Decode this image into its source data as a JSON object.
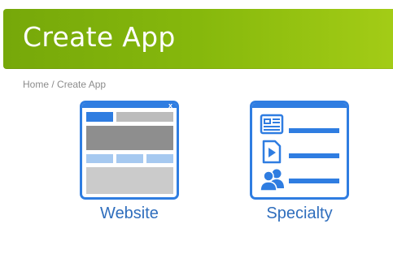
{
  "header": {
    "title": "Create App"
  },
  "breadcrumb": {
    "home": "Home",
    "separator": " / ",
    "current": "Create App"
  },
  "tiles": [
    {
      "label": "Website",
      "icon": "website-layout-icon",
      "close_glyph": "x"
    },
    {
      "label": "Specialty",
      "icon": "specialty-list-icon"
    }
  ],
  "colors": {
    "header_start": "#76a80a",
    "header_end": "#a3cc16",
    "accent_blue": "#2f7de1",
    "label_blue": "#2f6ebd",
    "breadcrumb_gray": "#8c8c8c"
  }
}
